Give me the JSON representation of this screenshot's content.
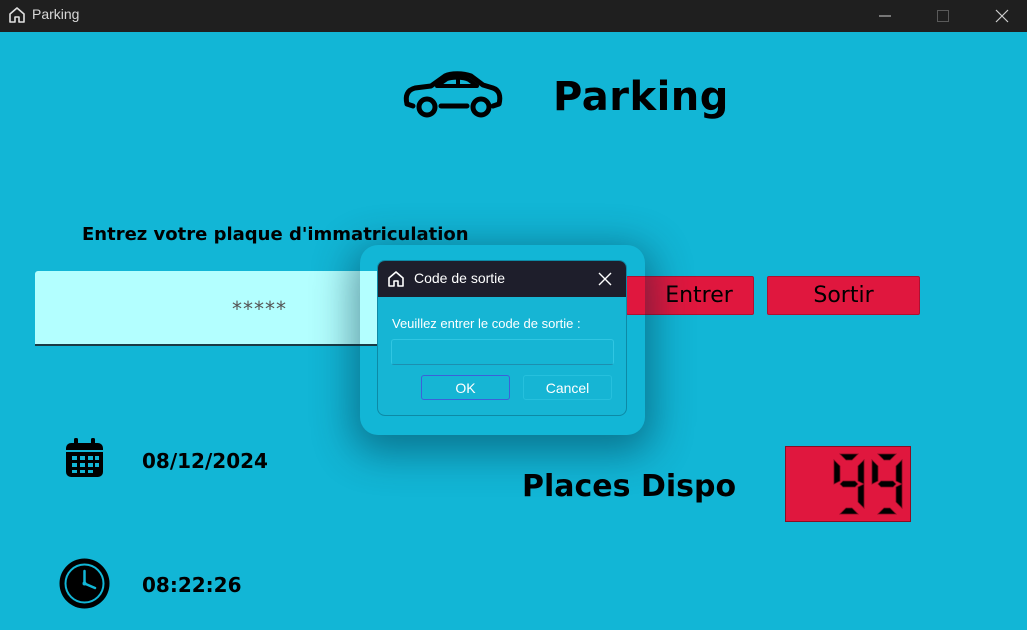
{
  "window": {
    "title": "Parking",
    "icon": "home-icon"
  },
  "header": {
    "title": "Parking",
    "icon": "car-icon"
  },
  "plate": {
    "label": "Entrez votre plaque d'immatriculation",
    "value": "*****"
  },
  "buttons": {
    "entrer": "Entrer",
    "sortir": "Sortir"
  },
  "info": {
    "date": "08/12/2024",
    "time": "08:22:26",
    "places_label": "Places Dispo",
    "places_value": "99"
  },
  "dialog": {
    "title": "Code de sortie",
    "prompt": "Veuillez entrer le code de sortie :",
    "input_value": "",
    "ok": "OK",
    "cancel": "Cancel"
  },
  "colors": {
    "background": "#12b6d6",
    "accent_red": "#e0173e",
    "input_bg": "#b3ffff",
    "titlebar": "#1f1f1f"
  }
}
